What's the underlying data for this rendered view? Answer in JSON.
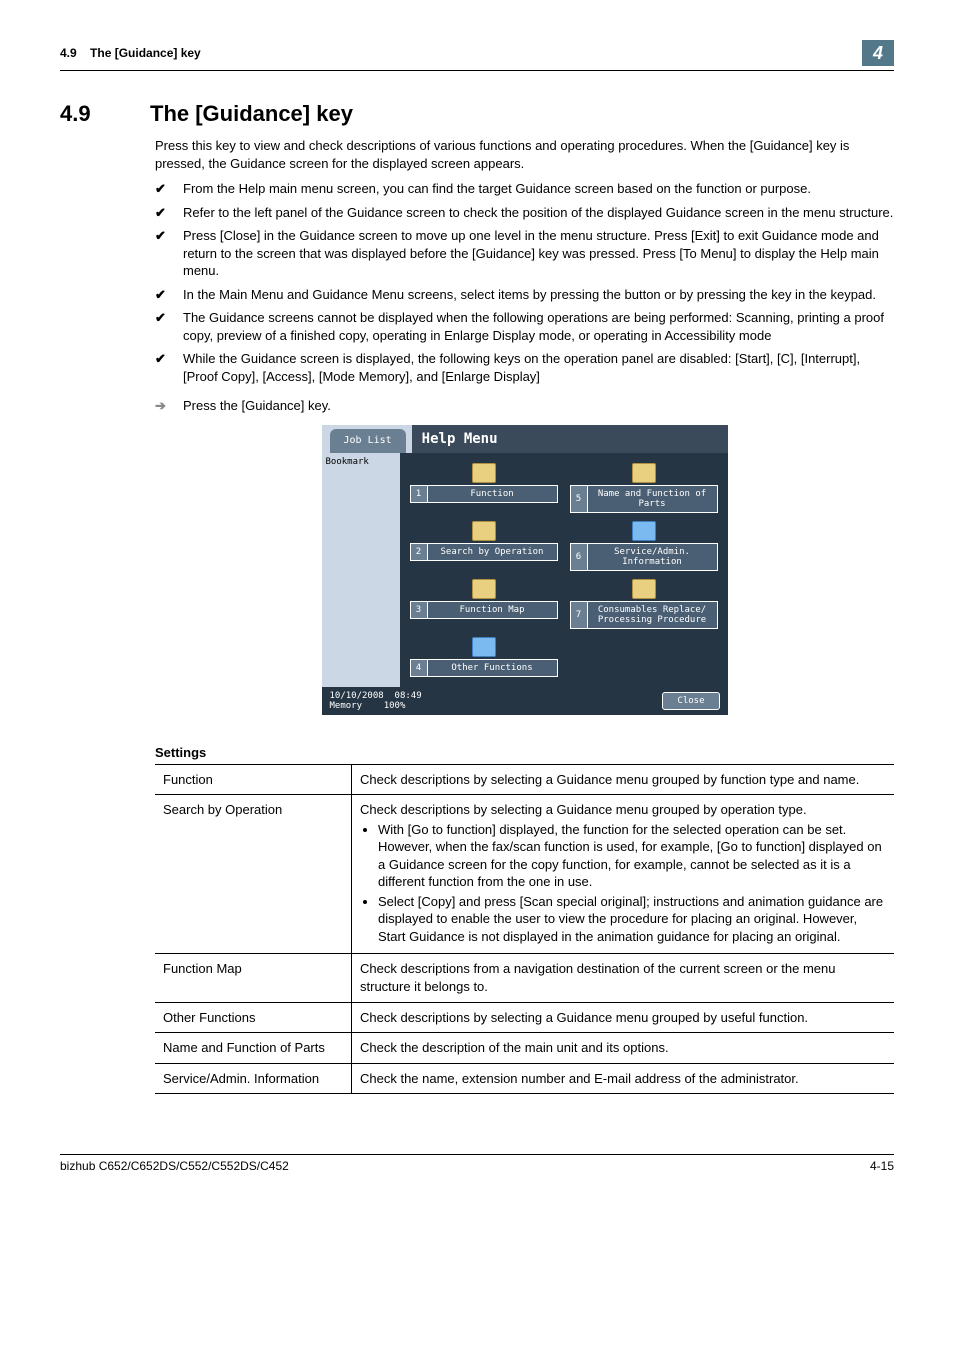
{
  "header": {
    "section_ref": "4.9",
    "section_title_short": "The [Guidance] key",
    "chapter_num": "4"
  },
  "title": {
    "num": "4.9",
    "text": "The [Guidance] key"
  },
  "intro": "Press this key to view and check descriptions of various functions and operating procedures. When the [Guidance] key is pressed, the Guidance screen for the displayed screen appears.",
  "checks": [
    "From the Help main menu screen, you can find the target Guidance screen based on the function or purpose.",
    "Refer to the left panel of the Guidance screen to check the position of the displayed Guidance screen in the menu structure.",
    "Press [Close] in the Guidance screen to move up one level in the menu structure. Press [Exit] to exit Guidance mode and return to the screen that was displayed before the [Guidance] key was pressed. Press [To Menu] to display the Help main menu.",
    "In the Main Menu and Guidance Menu screens, select items by pressing the button or by pressing the key in the keypad.",
    "The Guidance screens cannot be displayed when the following operations are being performed: Scanning, printing a proof copy, preview of a finished copy, operating in Enlarge Display mode, or operating in Accessibility mode",
    "While the Guidance screen is displayed, the following keys on the operation panel are disabled: [Start], [C], [Interrupt], [Proof Copy], [Access], [Mode Memory], and [Enlarge Display]"
  ],
  "step": "Press the [Guidance] key.",
  "panel": {
    "tab": "Job List",
    "title": "Help Menu",
    "bookmark": "Bookmark",
    "items": [
      {
        "n": "1",
        "label": "Function"
      },
      {
        "n": "5",
        "label": "Name and Function of Parts"
      },
      {
        "n": "2",
        "label": "Search by Operation"
      },
      {
        "n": "6",
        "label": "Service/Admin. Information"
      },
      {
        "n": "3",
        "label": "Function Map"
      },
      {
        "n": "7",
        "label": "Consumables Replace/ Processing Procedure"
      },
      {
        "n": "4",
        "label": "Other Functions"
      }
    ],
    "footer_date": "10/10/2008",
    "footer_time": "08:49",
    "footer_mem": "Memory",
    "footer_pct": "100%",
    "close": "Close"
  },
  "settings_title": "Settings",
  "settings": [
    {
      "name": "Function",
      "desc": "Check descriptions by selecting a Guidance menu grouped by function type and name."
    },
    {
      "name": "Search by Operation",
      "desc": "Check descriptions by selecting a Guidance menu grouped by operation type.",
      "bullets": [
        "With [Go to function] displayed, the function for the selected operation can be set. However, when the fax/scan function is used, for example, [Go to function] displayed on a Guidance screen for the copy function, for example, cannot be selected as it is a different function from the one in use.",
        "Select [Copy] and press [Scan special original]; instructions and animation guidance are displayed to enable the user to view the procedure for placing an original. However, Start Guidance is not displayed in the animation guidance for placing an original."
      ]
    },
    {
      "name": "Function Map",
      "desc": "Check descriptions from a navigation destination of the current screen or the menu structure it belongs to."
    },
    {
      "name": "Other Functions",
      "desc": "Check descriptions by selecting a Guidance menu grouped by useful function."
    },
    {
      "name": "Name and Function of Parts",
      "desc": "Check the description of the main unit and its options."
    },
    {
      "name": "Service/Admin. Information",
      "desc": "Check the name, extension number and E-mail address of the administrator."
    }
  ],
  "footer": {
    "left": "bizhub C652/C652DS/C552/C552DS/C452",
    "right": "4-15"
  }
}
